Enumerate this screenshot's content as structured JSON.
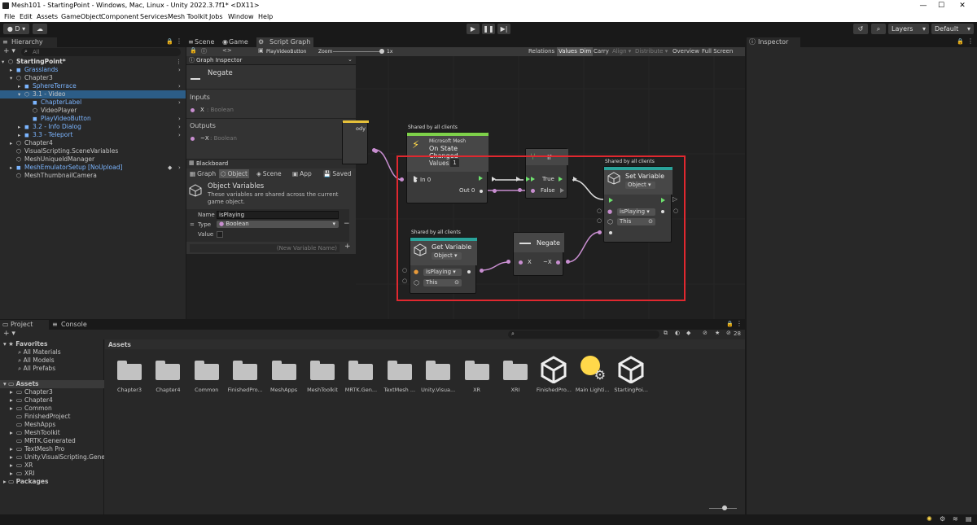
{
  "window": {
    "title": "Mesh101 - StartingPoint - Windows, Mac, Linux - Unity 2022.3.7f1* <DX11>",
    "minimize": "—",
    "maximize": "☐",
    "close": "✕"
  },
  "menu": [
    "File",
    "Edit",
    "Assets",
    "GameObject",
    "Component",
    "Services",
    "Mesh Toolkit",
    "Jobs",
    "Window",
    "Help"
  ],
  "toolbar": {
    "account": "D ▾",
    "layers": "Layers",
    "layout": "Default"
  },
  "hierarchy": {
    "tab": "Hierarchy",
    "search_placeholder": "All",
    "rows": [
      {
        "label": "StartingPoint*",
        "indent": 0,
        "blue": false,
        "bold": true
      },
      {
        "label": "Grasslands",
        "indent": 1,
        "blue": true
      },
      {
        "label": "Chapter3",
        "indent": 1,
        "blue": false
      },
      {
        "label": "SphereTerrace",
        "indent": 2,
        "blue": true
      },
      {
        "label": "3.1 - Video",
        "indent": 2,
        "blue": false
      },
      {
        "label": "ChapterLabel",
        "indent": 3,
        "blue": true
      },
      {
        "label": "VideoPlayer",
        "indent": 3,
        "blue": false
      },
      {
        "label": "PlayVideoButton",
        "indent": 3,
        "blue": true
      },
      {
        "label": "3.2 - Info Dialog",
        "indent": 2,
        "blue": true
      },
      {
        "label": "3.3 - Teleport",
        "indent": 2,
        "blue": true
      },
      {
        "label": "Chapter4",
        "indent": 1,
        "blue": false
      },
      {
        "label": "VisualScripting.SceneVariables",
        "indent": 1,
        "blue": false
      },
      {
        "label": "MeshUniqueIdManager",
        "indent": 1,
        "blue": false
      },
      {
        "label": "MeshEmulatorSetup [NoUpload]",
        "indent": 1,
        "blue": true
      },
      {
        "label": "MeshThumbnailCamera",
        "indent": 1,
        "blue": false
      }
    ]
  },
  "center_tabs": [
    "Scene",
    "Game",
    "Script Graph"
  ],
  "graph_toolbar": {
    "breadcrumb": "PlayVideoButton",
    "zoom_label": "Zoom",
    "zoom_value": "1x",
    "buttons": [
      "Relations",
      "Values",
      "Dim",
      "Carry",
      "Align ▾",
      "Distribute ▾",
      "Overview",
      "Full Screen"
    ]
  },
  "graph_inspector": {
    "title": "Graph Inspector",
    "node_name": "Negate",
    "inputs_label": "Inputs",
    "input_port": "X",
    "input_type": ": Boolean",
    "outputs_label": "Outputs",
    "output_port": "~X",
    "output_type": ": Boolean"
  },
  "blackboard": {
    "title": "Blackboard",
    "tabs": [
      "Graph",
      "Object",
      "Scene",
      "App",
      "Saved"
    ],
    "section_title": "Object Variables",
    "section_desc": "These variables are shared across the current game object.",
    "name_label": "Name",
    "name_value": "isPlaying",
    "type_label": "Type",
    "type_value": "Boolean",
    "value_label": "Value",
    "new_var_placeholder": "(New Variable Name)"
  },
  "nodes": {
    "partial": "ody",
    "state_changed": {
      "shared": "Shared by all clients",
      "subtitle": "Microsoft Mesh",
      "title": "On State Changed",
      "values_label": "Values",
      "values_count": "1",
      "in0": "In 0",
      "out0": "Out 0"
    },
    "if": {
      "title": "If",
      "true_label": "True",
      "false_label": "False"
    },
    "set_var": {
      "shared": "Shared by all clients",
      "title": "Set Variable",
      "kind": "Object ▾",
      "var": "isPlaying ▾",
      "target": "This"
    },
    "get_var": {
      "shared": "Shared by all clients",
      "title": "Get Variable",
      "kind": "Object ▾",
      "var": "isPlaying ▾",
      "target": "This"
    },
    "negate": {
      "title": "Negate",
      "x": "X",
      "nx": "~X"
    }
  },
  "inspector": {
    "tab": "Inspector"
  },
  "project": {
    "tabs": [
      "Project",
      "Console"
    ],
    "favorites": "Favorites",
    "fav_items": [
      "All Materials",
      "All Models",
      "All Prefabs"
    ],
    "assets_root": "Assets",
    "asset_tree": [
      "Chapter3",
      "Chapter4",
      "Common",
      "FinishedProject",
      "MeshApps",
      "MeshToolkit",
      "MRTK.Generated",
      "TextMesh Pro",
      "Unity.VisualScripting.Genera",
      "XR",
      "XRI"
    ],
    "packages": "Packages",
    "breadcrumb": "Assets",
    "count": "28",
    "assets": [
      "Chapter3",
      "Chapter4",
      "Common",
      "FinishedPro...",
      "MeshApps",
      "MeshToolkit",
      "MRTK.Gen...",
      "TextMesh ...",
      "Unity.Visua...",
      "XR",
      "XRI",
      "FinishedPro...",
      "Main Lighti...",
      "StartingPoi..."
    ]
  },
  "colors": {
    "highlight": "#e0282f",
    "green_bar": "#7ed14a",
    "teal_bar": "#2aa39a",
    "port_purple": "#c88ed0",
    "flow_green": "#6ee26e"
  }
}
